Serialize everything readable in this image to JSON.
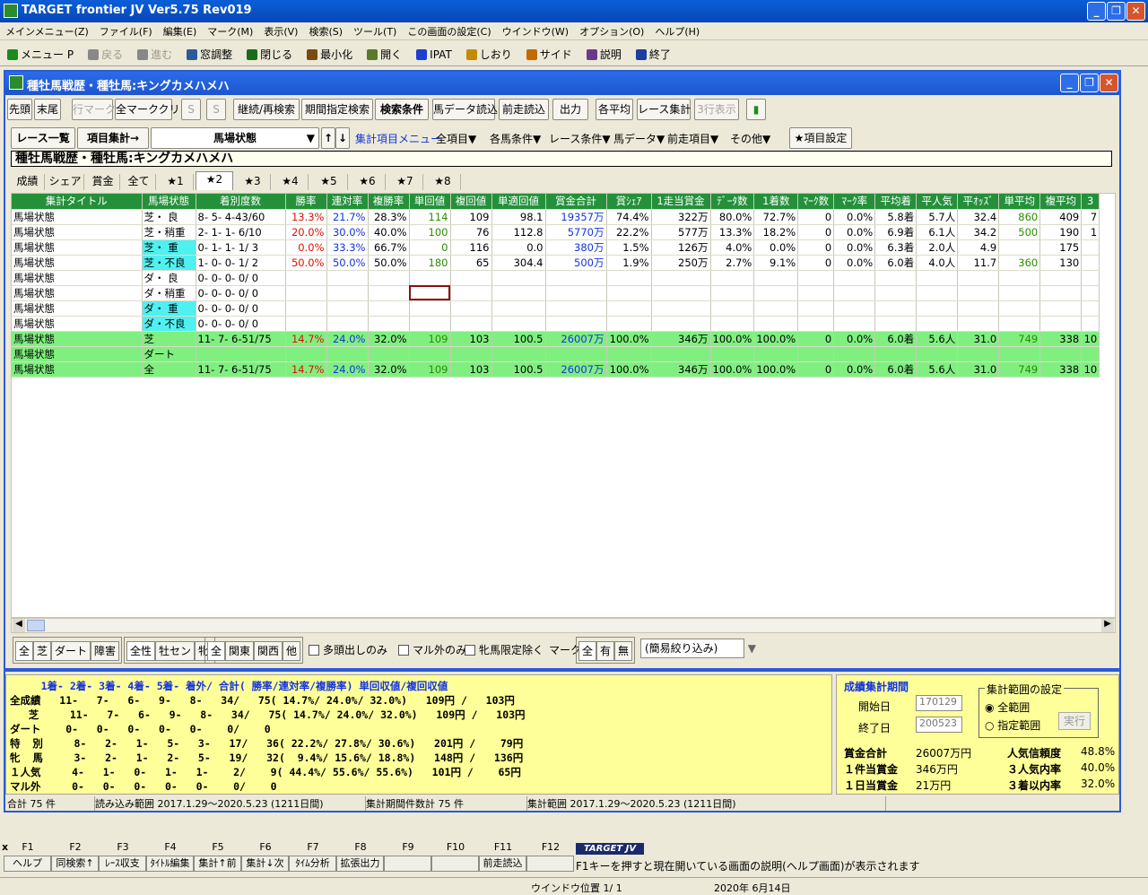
{
  "app": {
    "title": "TARGET frontier JV  Ver5.75  Rev019"
  },
  "menu": [
    "メインメニュー(Z)",
    "ファイル(F)",
    "編集(E)",
    "マーク(M)",
    "表示(V)",
    "検索(S)",
    "ツール(T)",
    "この画面の設定(C)",
    "ウインドウ(W)",
    "オプション(O)",
    "ヘルプ(H)"
  ],
  "toolbar": [
    {
      "label": "メニュー P",
      "on": true
    },
    {
      "label": "戻る",
      "on": false
    },
    {
      "label": "進む",
      "on": false
    },
    {
      "label": "窓調整",
      "on": true
    },
    {
      "label": "閉じる",
      "on": true
    },
    {
      "label": "最小化",
      "on": true
    },
    {
      "label": "開く",
      "on": true
    },
    {
      "label": "IPAT",
      "on": true
    },
    {
      "label": "しおり",
      "on": true
    },
    {
      "label": "サイド",
      "on": true
    },
    {
      "label": "説明",
      "on": true
    },
    {
      "label": "終了",
      "on": true
    }
  ],
  "window": {
    "title": "種牡馬戦歴・種牡馬:キングカメハメハ"
  },
  "buttons": [
    "先頭",
    "末尾",
    "行マーク",
    "全マーククリア",
    "S",
    "S",
    "継続/再検索",
    "期間指定検索",
    "検索条件",
    "馬データ読込",
    "前走読込",
    "出力",
    "各平均",
    "レース集計",
    "3行表示"
  ],
  "row2": {
    "race_list": "レース一覧",
    "item_sum": "項目集計→",
    "combo": "馬場状態",
    "menu_label": "集計項目メニュー",
    "menus": [
      "全項目▼",
      "各馬条件▼",
      "レース条件▼",
      "馬データ▼",
      "前走項目▼",
      "その他▼"
    ],
    "item_setting": "★項目設定"
  },
  "panel_title": "種牡馬戦歴・種牡馬:キングカメハメハ",
  "tabs": [
    "成績",
    "シェア",
    "賞金",
    "全て",
    "★1",
    "★2",
    "★3",
    "★4",
    "★5",
    "★6",
    "★7",
    "★8"
  ],
  "table": {
    "headers": [
      "集計タイトル",
      "馬場状態",
      "着別度数",
      "勝率",
      "連対率",
      "複勝率",
      "単回値",
      "複回値",
      "単適回値",
      "賞金合計",
      "賞ｼｪｱ",
      "1走当賞金",
      "ﾃﾞｰﾀ数",
      "1着数",
      "ﾏｰｸ数",
      "ﾏｰｸ率",
      "平均着",
      "平人気",
      "平ｵｯｽﾞ",
      "単平均",
      "複平均",
      "3"
    ],
    "rows": [
      [
        "馬場状態",
        "芝・ 良",
        "8- 5- 4-43/60",
        "13.3%",
        "21.7%",
        "28.3%",
        "114",
        "109",
        "98.1",
        "19357万",
        "74.4%",
        "322万",
        "80.0%",
        "72.7%",
        "0",
        "0.0%",
        "5.8着",
        "5.7人",
        "32.4",
        "860",
        "409",
        "7"
      ],
      [
        "馬場状態",
        "芝・稍重",
        "2- 1- 1- 6/10",
        "20.0%",
        "30.0%",
        "40.0%",
        "100",
        "76",
        "112.8",
        "5770万",
        "22.2%",
        "577万",
        "13.3%",
        "18.2%",
        "0",
        "0.0%",
        "6.9着",
        "6.1人",
        "34.2",
        "500",
        "190",
        "1"
      ],
      [
        "馬場状態",
        "芝・ 重",
        "0- 1- 1- 1/ 3",
        "0.0%",
        "33.3%",
        "66.7%",
        "0",
        "116",
        "0.0",
        "380万",
        "1.5%",
        "126万",
        "4.0%",
        "0.0%",
        "0",
        "0.0%",
        "6.3着",
        "2.0人",
        "4.9",
        "",
        "175",
        ""
      ],
      [
        "馬場状態",
        "芝・不良",
        "1- 0- 0- 1/ 2",
        "50.0%",
        "50.0%",
        "50.0%",
        "180",
        "65",
        "304.4",
        "500万",
        "1.9%",
        "250万",
        "2.7%",
        "9.1%",
        "0",
        "0.0%",
        "6.0着",
        "4.0人",
        "11.7",
        "360",
        "130",
        ""
      ],
      [
        "馬場状態",
        "ダ・ 良",
        "0- 0- 0- 0/ 0",
        "",
        "",
        "",
        "",
        "",
        "",
        "",
        "",
        "",
        "",
        "",
        "",
        "",
        "",
        "",
        "",
        "",
        "",
        ""
      ],
      [
        "馬場状態",
        "ダ・稍重",
        "0- 0- 0- 0/ 0",
        "",
        "",
        "",
        "",
        "",
        "",
        "",
        "",
        "",
        "",
        "",
        "",
        "",
        "",
        "",
        "",
        "",
        "",
        ""
      ],
      [
        "馬場状態",
        "ダ・ 重",
        "0- 0- 0- 0/ 0",
        "",
        "",
        "",
        "",
        "",
        "",
        "",
        "",
        "",
        "",
        "",
        "",
        "",
        "",
        "",
        "",
        "",
        "",
        ""
      ],
      [
        "馬場状態",
        "ダ・不良",
        "0- 0- 0- 0/ 0",
        "",
        "",
        "",
        "",
        "",
        "",
        "",
        "",
        "",
        "",
        "",
        "",
        "",
        "",
        "",
        "",
        "",
        "",
        ""
      ],
      [
        "馬場状態",
        "芝",
        "11- 7- 6-51/75",
        "14.7%",
        "24.0%",
        "32.0%",
        "109",
        "103",
        "100.5",
        "26007万",
        "100.0%",
        "346万",
        "100.0%",
        "100.0%",
        "0",
        "0.0%",
        "6.0着",
        "5.6人",
        "31.0",
        "749",
        "338",
        "10"
      ],
      [
        "馬場状態",
        "ダート",
        "",
        "",
        "",
        "",
        "",
        "",
        "",
        "",
        "",
        "",
        "",
        "",
        "",
        "",
        "",
        "",
        "",
        "",
        "",
        ""
      ],
      [
        "馬場状態",
        "全",
        "11- 7- 6-51/75",
        "14.7%",
        "24.0%",
        "32.0%",
        "109",
        "103",
        "100.5",
        "26007万",
        "100.0%",
        "346万",
        "100.0%",
        "100.0%",
        "0",
        "0.0%",
        "6.0着",
        "5.6人",
        "31.0",
        "749",
        "338",
        "10"
      ]
    ]
  },
  "filters": {
    "g1": [
      "全",
      "芝",
      "ダート",
      "障害"
    ],
    "g2": [
      "全性",
      "牡セン",
      "牝"
    ],
    "g3": [
      "全",
      "関東",
      "関西",
      "他"
    ],
    "checks": [
      "多頭出しのみ",
      "マル外のみ",
      "牝馬限定除く"
    ],
    "mark": "マーク",
    "g4": [
      "全",
      "有",
      "無"
    ],
    "quick": "(簡易絞り込み)"
  },
  "summary": {
    "header": "     1着- 2着- 3着- 4着- 5着- 着外/ 合計( 勝率/連対率/複勝率) 単回収値/複回収値",
    "lines": [
      "全成績   11-   7-   6-   9-   8-   34/   75( 14.7%/ 24.0%/ 32.0%)   109円 /   103円",
      "   芝     11-   7-   6-   9-   8-   34/   75( 14.7%/ 24.0%/ 32.0%)   109円 /   103円",
      "ダート    0-   0-   0-   0-   0-    0/    0",
      "特  別     8-   2-   1-   5-   3-   17/   36( 22.2%/ 27.8%/ 30.6%)   201円 /    79円",
      "牝  馬     3-   2-   1-   2-   5-   19/   32(  9.4%/ 15.6%/ 18.8%)   148円 /   136円",
      "１人気     4-   1-   0-   1-   1-    2/    9( 44.4%/ 55.6%/ 55.6%)   101円 /    65円",
      "マル外     0-   0-   0-   0-   0-    0/    0"
    ]
  },
  "period": {
    "title": "成績集計期間",
    "start_label": "開始日",
    "start": "170129",
    "end_label": "終了日",
    "end": "200523",
    "range_title": "集計範囲の設定",
    "all": "全範囲",
    "spec": "指定範囲",
    "run": "実行",
    "stats": [
      [
        "賞金合計",
        "26007万円",
        "人気信頼度",
        "48.8%"
      ],
      [
        "１件当賞金",
        "346万円",
        "３人気内率",
        "40.0%"
      ],
      [
        "１日当賞金",
        "21万円",
        "３着以内率",
        "32.0%"
      ]
    ]
  },
  "status_inner": [
    "合計 75 件",
    "読み込み範囲 2017.1.29〜2020.5.23 (1211日間)",
    "集計期間件数計 75 件",
    "集計範囲 2017.1.29〜2020.5.23 (1211日間)"
  ],
  "fkeys": [
    [
      "F1",
      "ヘルプ"
    ],
    [
      "F2",
      "同検索↑"
    ],
    [
      "F3",
      "ﾚｰｽ収支"
    ],
    [
      "F4",
      "ﾀｲﾄﾙ編集"
    ],
    [
      "F5",
      "集計↑前"
    ],
    [
      "F6",
      "集計↓次"
    ],
    [
      "F7",
      "ﾀｲﾑ分析"
    ],
    [
      "F8",
      "拡張出力"
    ],
    [
      "F9",
      ""
    ],
    [
      "F10",
      ""
    ],
    [
      "F11",
      "前走読込"
    ],
    [
      "F12",
      ""
    ]
  ],
  "brand": "TARGET JV",
  "help_text": "F1キーを押すと現在開いている画面の説明(ヘルプ画面)が表示されます",
  "bottom_status": {
    "window_pos": "ウインドウ位置 1/ 1",
    "date": "2020年 6月14日"
  }
}
